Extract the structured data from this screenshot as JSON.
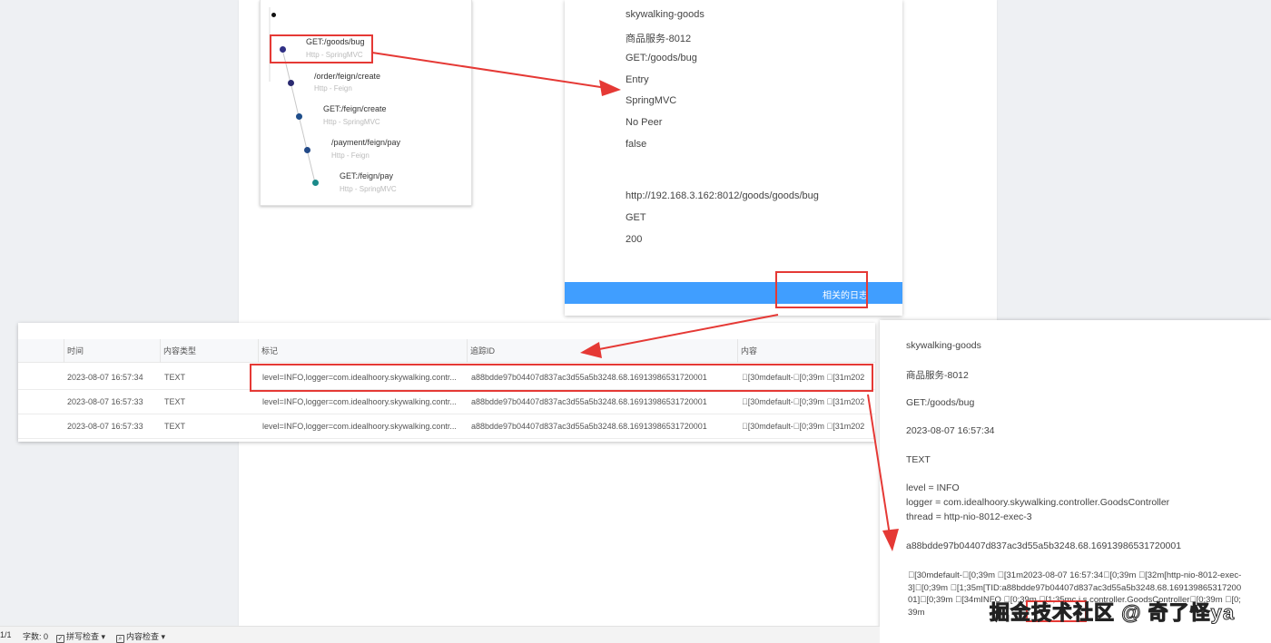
{
  "trace_tree": {
    "spans": [
      {
        "title": "GET:/goods/bug",
        "sub": "Http - SpringMVC",
        "color": "#303085"
      },
      {
        "title": "/order/feign/create",
        "sub": "Http - Feign",
        "color": "#2a2a70"
      },
      {
        "title": "GET:/feign/create",
        "sub": "Http - SpringMVC",
        "color": "#1f4e8a"
      },
      {
        "title": "/payment/feign/pay",
        "sub": "Http - Feign",
        "color": "#234a88"
      },
      {
        "title": "GET:/feign/pay",
        "sub": "Http - SpringMVC",
        "color": "#1a8a8a"
      }
    ]
  },
  "span_detail": {
    "lines": [
      "skywalking-goods",
      "商品服务-8012",
      "GET:/goods/bug",
      "Entry",
      "SpringMVC",
      "No Peer",
      "false",
      "http://192.168.3.162:8012/goods/goods/bug",
      "GET",
      "200"
    ],
    "related_logs_label": "相关的日志",
    "bar_color": "#409eff"
  },
  "log_table": {
    "headers": [
      "时间",
      "内容类型",
      "标记",
      "追踪ID",
      "内容"
    ],
    "rows": [
      {
        "time": "2023-08-07 16:57:34",
        "type": "TEXT",
        "tags": "level=INFO,logger=com.idealhoory.skywalking.contr...",
        "trace_id": "a88bdde97b04407d837ac3d55a5b3248.68.16913986531720001",
        "content": "\u0000[30mdefault-\u0000[0;39m \u0000[31m202"
      },
      {
        "time": "2023-08-07 16:57:33",
        "type": "TEXT",
        "tags": "level=INFO,logger=com.idealhoory.skywalking.contr...",
        "trace_id": "a88bdde97b04407d837ac3d55a5b3248.68.16913986531720001",
        "content": "\u0000[30mdefault-\u0000[0;39m \u0000[31m202"
      },
      {
        "time": "2023-08-07 16:57:33",
        "type": "TEXT",
        "tags": "level=INFO,logger=com.idealhoory.skywalking.contr...",
        "trace_id": "a88bdde97b04407d837ac3d55a5b3248.68.16913986531720001",
        "content": "\u0000[30mdefault-\u0000[0;39m \u0000[31m202"
      }
    ]
  },
  "log_detail": {
    "service": "skywalking-goods",
    "instance": "商品服务-8012",
    "endpoint": "GET:/goods/bug",
    "time": "2023-08-07 16:57:34",
    "type": "TEXT",
    "tag_level": "level = INFO",
    "tag_logger": "logger = com.idealhoory.skywalking.controller.GoodsController",
    "tag_thread": "thread = http-nio-8012-exec-3",
    "trace_id": "a88bdde97b04407d837ac3d55a5b3248.68.16913986531720001",
    "content": "\u0000[30mdefault-\u0000[0;39m \u0000[31m2023-08-07 16:57:34\u0000[0;39m \u0000[32m[http-nio-8012-exec-3]\u0000[0;39m \u0000[1;35m[TID:a88bdde97b04407d837ac3d55a5b3248.68.16913986531720001]\u0000[0;39m \u0000[34mINFO \u0000[0;39m \u0000[1;35mc.i.s.controller.GoodsController\u0000[0;39m \u0000[0;39m"
  },
  "status_bar": {
    "page": "1/1",
    "word_count": "字数: 0",
    "spell_check": "拼写检查",
    "content_check": "内容检查"
  },
  "watermark": "掘金技术社区 @ 奇了怪ya",
  "annotation_color": "#e53935"
}
